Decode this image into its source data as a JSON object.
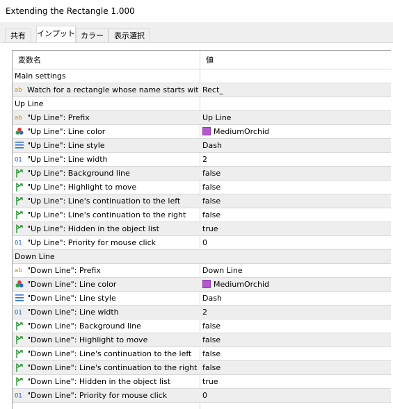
{
  "window": {
    "title": "Extending the Rectangle 1.000"
  },
  "tabs": [
    {
      "label": "共有",
      "active": false
    },
    {
      "label": "インプット",
      "active": true
    },
    {
      "label": "カラー",
      "active": false
    },
    {
      "label": "表示選択",
      "active": false
    }
  ],
  "table": {
    "headers": {
      "name": "変数名",
      "value": "値"
    },
    "rows": [
      {
        "kind": "section",
        "name": "Main settings"
      },
      {
        "kind": "param",
        "icon": "string-icon",
        "name": "Watch for a rectangle whose name starts wit...",
        "value": "Rect_"
      },
      {
        "kind": "section",
        "name": "Up Line"
      },
      {
        "kind": "param",
        "icon": "string-icon",
        "name": "\"Up Line\": Prefix",
        "value": "Up Line"
      },
      {
        "kind": "param",
        "icon": "color-icon",
        "name": "\"Up Line\": Line color",
        "value": "MediumOrchid",
        "swatch": "#ba55d3"
      },
      {
        "kind": "param",
        "icon": "line-style-icon",
        "name": "\"Up Line\": Line style",
        "value": "Dash"
      },
      {
        "kind": "param",
        "icon": "integer-icon",
        "name": "\"Up Line\": Line width",
        "value": "2"
      },
      {
        "kind": "param",
        "icon": "bool-icon",
        "name": "\"Up Line\": Background line",
        "value": "false"
      },
      {
        "kind": "param",
        "icon": "bool-icon",
        "name": "\"Up Line\": Highlight to move",
        "value": "false"
      },
      {
        "kind": "param",
        "icon": "bool-icon",
        "name": "\"Up Line\": Line's continuation to the left",
        "value": "false"
      },
      {
        "kind": "param",
        "icon": "bool-icon",
        "name": "\"Up Line\": Line's continuation to the right",
        "value": "false"
      },
      {
        "kind": "param",
        "icon": "bool-icon",
        "name": "\"Up Line\": Hidden in the object list",
        "value": "true"
      },
      {
        "kind": "param",
        "icon": "integer-icon",
        "name": "\"Up Line\": Priority for mouse click",
        "value": "0"
      },
      {
        "kind": "section",
        "name": "Down Line"
      },
      {
        "kind": "param",
        "icon": "string-icon",
        "name": "\"Down Line\": Prefix",
        "value": "Down Line"
      },
      {
        "kind": "param",
        "icon": "color-icon",
        "name": "\"Down Line\": Line color",
        "value": "MediumOrchid",
        "swatch": "#ba55d3"
      },
      {
        "kind": "param",
        "icon": "line-style-icon",
        "name": "\"Down Line\": Line style",
        "value": "Dash"
      },
      {
        "kind": "param",
        "icon": "integer-icon",
        "name": "\"Down Line\": Line width",
        "value": "2"
      },
      {
        "kind": "param",
        "icon": "bool-icon",
        "name": "\"Down Line\": Background line",
        "value": "false"
      },
      {
        "kind": "param",
        "icon": "bool-icon",
        "name": "\"Down Line\": Highlight to move",
        "value": "false"
      },
      {
        "kind": "param",
        "icon": "bool-icon",
        "name": "\"Down Line\": Line's continuation to the left",
        "value": "false"
      },
      {
        "kind": "param",
        "icon": "bool-icon",
        "name": "\"Down Line\": Line's continuation to the right",
        "value": "false"
      },
      {
        "kind": "param",
        "icon": "bool-icon",
        "name": "\"Down Line\": Hidden in the object list",
        "value": "true"
      },
      {
        "kind": "param",
        "icon": "integer-icon",
        "name": "\"Down Line\": Priority for mouse click",
        "value": "0"
      }
    ]
  },
  "colors": {
    "string_icon": "#c08a20",
    "integer_icon": "#2060c0",
    "bool_icon": "#2e9a3a",
    "line_style_icon": "#2f6fd0",
    "row_alt": "#eeeeee"
  }
}
